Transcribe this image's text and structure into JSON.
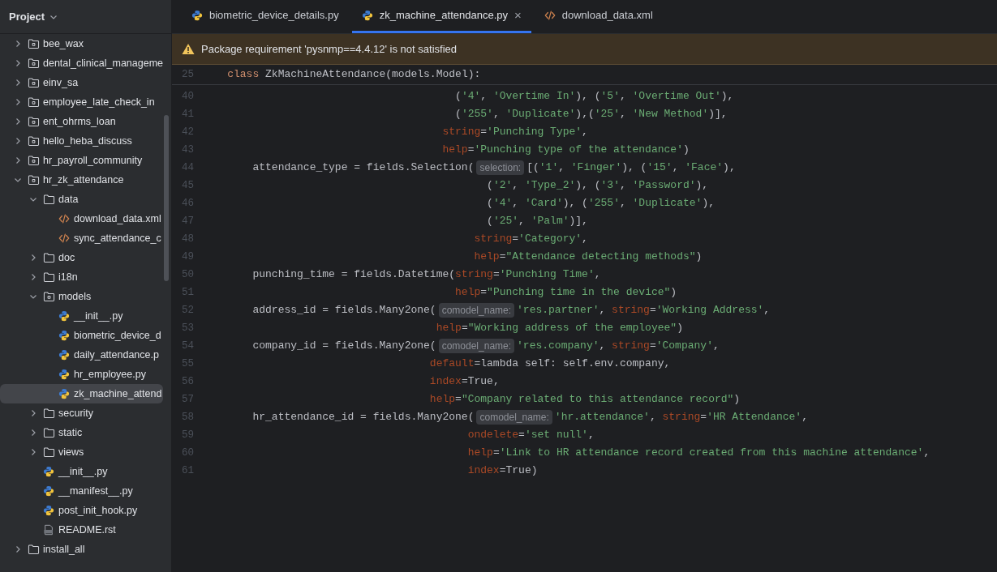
{
  "sidebar": {
    "title": "Project",
    "tree": [
      {
        "label": "bee_wax",
        "kind": "module",
        "expanded": false,
        "selected": false
      },
      {
        "label": "dental_clinical_manageme",
        "kind": "module",
        "expanded": false,
        "selected": false
      },
      {
        "label": "einv_sa",
        "kind": "module",
        "expanded": false,
        "selected": false
      },
      {
        "label": "employee_late_check_in",
        "kind": "module",
        "expanded": false,
        "selected": false
      },
      {
        "label": "ent_ohrms_loan",
        "kind": "module",
        "expanded": false,
        "selected": false
      },
      {
        "label": "hello_heba_discuss",
        "kind": "module",
        "expanded": false,
        "selected": false
      },
      {
        "label": "hr_payroll_community",
        "kind": "module",
        "expanded": false,
        "selected": false
      },
      {
        "label": "hr_zk_attendance",
        "kind": "module",
        "expanded": true,
        "selected": false,
        "children": [
          {
            "label": "data",
            "kind": "folder",
            "expanded": true,
            "selected": false,
            "children": [
              {
                "label": "download_data.xml",
                "kind": "xml",
                "selected": false
              },
              {
                "label": "sync_attendance_c",
                "kind": "xml",
                "selected": false
              }
            ]
          },
          {
            "label": "doc",
            "kind": "folder",
            "expanded": false,
            "selected": false
          },
          {
            "label": "i18n",
            "kind": "folder",
            "expanded": false,
            "selected": false
          },
          {
            "label": "models",
            "kind": "module",
            "expanded": true,
            "selected": false,
            "children": [
              {
                "label": "__init__.py",
                "kind": "python",
                "selected": false
              },
              {
                "label": "biometric_device_d",
                "kind": "python",
                "selected": false
              },
              {
                "label": "daily_attendance.p",
                "kind": "python",
                "selected": false
              },
              {
                "label": "hr_employee.py",
                "kind": "python",
                "selected": false
              },
              {
                "label": "zk_machine_attend",
                "kind": "python",
                "selected": true
              }
            ]
          },
          {
            "label": "security",
            "kind": "folder",
            "expanded": false,
            "selected": false
          },
          {
            "label": "static",
            "kind": "folder",
            "expanded": false,
            "selected": false
          },
          {
            "label": "views",
            "kind": "folder",
            "expanded": false,
            "selected": false
          },
          {
            "label": "__init__.py",
            "kind": "python",
            "selected": false
          },
          {
            "label": "__manifest__.py",
            "kind": "python",
            "selected": false
          },
          {
            "label": "post_init_hook.py",
            "kind": "python",
            "selected": false
          },
          {
            "label": "README.rst",
            "kind": "rst",
            "selected": false
          }
        ]
      },
      {
        "label": "install_all",
        "kind": "folder",
        "expanded": false,
        "selected": false
      }
    ]
  },
  "tabs": [
    {
      "label": "biometric_device_details.py",
      "kind": "python",
      "selected": false
    },
    {
      "label": "zk_machine_attendance.py",
      "kind": "python",
      "selected": true,
      "close": "×"
    },
    {
      "label": "download_data.xml",
      "kind": "xml",
      "selected": false
    }
  ],
  "banner": {
    "text": "Package requirement 'pysnmp==4.4.12' is not satisfied"
  },
  "editor": {
    "sticky_line": {
      "number": "25",
      "tokens": [
        {
          "kind": "keyword",
          "text": "    class"
        },
        {
          "kind": "plain",
          "text": " ZkMachineAttendance(models.Model):"
        }
      ]
    },
    "lines": [
      {
        "number": "40",
        "tokens": [
          {
            "kind": "plain",
            "text": "                                        ("
          },
          {
            "kind": "string",
            "text": "'4'"
          },
          {
            "kind": "plain",
            "text": ", "
          },
          {
            "kind": "string",
            "text": "'Overtime In'"
          },
          {
            "kind": "plain",
            "text": "), ("
          },
          {
            "kind": "string",
            "text": "'5'"
          },
          {
            "kind": "plain",
            "text": ", "
          },
          {
            "kind": "string",
            "text": "'Overtime Out'"
          },
          {
            "kind": "plain",
            "text": "),"
          }
        ]
      },
      {
        "number": "41",
        "tokens": [
          {
            "kind": "plain",
            "text": "                                        ("
          },
          {
            "kind": "string",
            "text": "'255'"
          },
          {
            "kind": "plain",
            "text": ", "
          },
          {
            "kind": "string",
            "text": "'Duplicate'"
          },
          {
            "kind": "plain",
            "text": "),("
          },
          {
            "kind": "string",
            "text": "'25'"
          },
          {
            "kind": "plain",
            "text": ", "
          },
          {
            "kind": "string",
            "text": "'New Method'"
          },
          {
            "kind": "plain",
            "text": ")],"
          }
        ]
      },
      {
        "number": "42",
        "tokens": [
          {
            "kind": "param",
            "text": "                                      string"
          },
          {
            "kind": "plain",
            "text": "="
          },
          {
            "kind": "string",
            "text": "'Punching Type'"
          },
          {
            "kind": "plain",
            "text": ","
          }
        ]
      },
      {
        "number": "43",
        "tokens": [
          {
            "kind": "param",
            "text": "                                      help"
          },
          {
            "kind": "plain",
            "text": "="
          },
          {
            "kind": "string",
            "text": "'Punching type of the attendance'"
          },
          {
            "kind": "plain",
            "text": ")"
          }
        ]
      },
      {
        "number": "44",
        "tokens": [
          {
            "kind": "plain",
            "text": "        attendance_type = fields.Selection("
          },
          {
            "kind": "hint",
            "text": "selection:"
          },
          {
            "kind": "plain",
            "text": "[("
          },
          {
            "kind": "string",
            "text": "'1'"
          },
          {
            "kind": "plain",
            "text": ", "
          },
          {
            "kind": "string",
            "text": "'Finger'"
          },
          {
            "kind": "plain",
            "text": "), ("
          },
          {
            "kind": "string",
            "text": "'15'"
          },
          {
            "kind": "plain",
            "text": ", "
          },
          {
            "kind": "string",
            "text": "'Face'"
          },
          {
            "kind": "plain",
            "text": "),"
          }
        ]
      },
      {
        "number": "45",
        "tokens": [
          {
            "kind": "plain",
            "text": "                                             ("
          },
          {
            "kind": "string",
            "text": "'2'"
          },
          {
            "kind": "plain",
            "text": ", "
          },
          {
            "kind": "string",
            "text": "'Type_2'"
          },
          {
            "kind": "plain",
            "text": "), ("
          },
          {
            "kind": "string",
            "text": "'3'"
          },
          {
            "kind": "plain",
            "text": ", "
          },
          {
            "kind": "string",
            "text": "'Password'"
          },
          {
            "kind": "plain",
            "text": "),"
          }
        ]
      },
      {
        "number": "46",
        "tokens": [
          {
            "kind": "plain",
            "text": "                                             ("
          },
          {
            "kind": "string",
            "text": "'4'"
          },
          {
            "kind": "plain",
            "text": ", "
          },
          {
            "kind": "string",
            "text": "'Card'"
          },
          {
            "kind": "plain",
            "text": "), ("
          },
          {
            "kind": "string",
            "text": "'255'"
          },
          {
            "kind": "plain",
            "text": ", "
          },
          {
            "kind": "string",
            "text": "'Duplicate'"
          },
          {
            "kind": "plain",
            "text": "),"
          }
        ]
      },
      {
        "number": "47",
        "tokens": [
          {
            "kind": "plain",
            "text": "                                             ("
          },
          {
            "kind": "string",
            "text": "'25'"
          },
          {
            "kind": "plain",
            "text": ", "
          },
          {
            "kind": "string",
            "text": "'Palm'"
          },
          {
            "kind": "plain",
            "text": ")],"
          }
        ]
      },
      {
        "number": "48",
        "tokens": [
          {
            "kind": "param",
            "text": "                                           string"
          },
          {
            "kind": "plain",
            "text": "="
          },
          {
            "kind": "string",
            "text": "'Category'"
          },
          {
            "kind": "plain",
            "text": ","
          }
        ]
      },
      {
        "number": "49",
        "tokens": [
          {
            "kind": "param",
            "text": "                                           help"
          },
          {
            "kind": "plain",
            "text": "="
          },
          {
            "kind": "string",
            "text": "\"Attendance detecting methods\""
          },
          {
            "kind": "plain",
            "text": ")"
          }
        ]
      },
      {
        "number": "50",
        "tokens": [
          {
            "kind": "plain",
            "text": "        punching_time = fields.Datetime("
          },
          {
            "kind": "param",
            "text": "string"
          },
          {
            "kind": "plain",
            "text": "="
          },
          {
            "kind": "string",
            "text": "'Punching Time'"
          },
          {
            "kind": "plain",
            "text": ","
          }
        ]
      },
      {
        "number": "51",
        "tokens": [
          {
            "kind": "param",
            "text": "                                        help"
          },
          {
            "kind": "plain",
            "text": "="
          },
          {
            "kind": "string",
            "text": "\"Punching time in the device\""
          },
          {
            "kind": "plain",
            "text": ")"
          }
        ]
      },
      {
        "number": "52",
        "tokens": [
          {
            "kind": "plain",
            "text": "        address_id = fields.Many2one("
          },
          {
            "kind": "hint",
            "text": "comodel_name:"
          },
          {
            "kind": "string",
            "text": "'res.partner'"
          },
          {
            "kind": "plain",
            "text": ", "
          },
          {
            "kind": "param",
            "text": "string"
          },
          {
            "kind": "plain",
            "text": "="
          },
          {
            "kind": "string",
            "text": "'Working Address'"
          },
          {
            "kind": "plain",
            "text": ","
          }
        ]
      },
      {
        "number": "53",
        "tokens": [
          {
            "kind": "param",
            "text": "                                     help"
          },
          {
            "kind": "plain",
            "text": "="
          },
          {
            "kind": "string",
            "text": "\"Working address of the employee\""
          },
          {
            "kind": "plain",
            "text": ")"
          }
        ]
      },
      {
        "number": "54",
        "tokens": [
          {
            "kind": "plain",
            "text": "        company_id = fields.Many2one("
          },
          {
            "kind": "hint",
            "text": "comodel_name:"
          },
          {
            "kind": "string",
            "text": "'res.company'"
          },
          {
            "kind": "plain",
            "text": ", "
          },
          {
            "kind": "param",
            "text": "string"
          },
          {
            "kind": "plain",
            "text": "="
          },
          {
            "kind": "string",
            "text": "'Company'"
          },
          {
            "kind": "plain",
            "text": ","
          }
        ]
      },
      {
        "number": "55",
        "tokens": [
          {
            "kind": "param",
            "text": "                                    default"
          },
          {
            "kind": "plain",
            "text": "=lambda self: self.env.company,"
          }
        ]
      },
      {
        "number": "56",
        "tokens": [
          {
            "kind": "param",
            "text": "                                    index"
          },
          {
            "kind": "plain",
            "text": "=True,"
          }
        ]
      },
      {
        "number": "57",
        "tokens": [
          {
            "kind": "param",
            "text": "                                    help"
          },
          {
            "kind": "plain",
            "text": "="
          },
          {
            "kind": "string",
            "text": "\"Company related to this attendance record\""
          },
          {
            "kind": "plain",
            "text": ")"
          }
        ]
      },
      {
        "number": "58",
        "tokens": [
          {
            "kind": "plain",
            "text": "        hr_attendance_id = fields.Many2one("
          },
          {
            "kind": "hint",
            "text": "comodel_name:"
          },
          {
            "kind": "string",
            "text": "'hr.attendance'"
          },
          {
            "kind": "plain",
            "text": ", "
          },
          {
            "kind": "param",
            "text": "string"
          },
          {
            "kind": "plain",
            "text": "="
          },
          {
            "kind": "string",
            "text": "'HR Attendance'"
          },
          {
            "kind": "plain",
            "text": ","
          }
        ]
      },
      {
        "number": "59",
        "tokens": [
          {
            "kind": "param",
            "text": "                                          ondelete"
          },
          {
            "kind": "plain",
            "text": "="
          },
          {
            "kind": "string",
            "text": "'set null'"
          },
          {
            "kind": "plain",
            "text": ","
          }
        ]
      },
      {
        "number": "60",
        "tokens": [
          {
            "kind": "param",
            "text": "                                          help"
          },
          {
            "kind": "plain",
            "text": "="
          },
          {
            "kind": "string",
            "text": "'Link to HR attendance record created from this machine attendance'"
          },
          {
            "kind": "plain",
            "text": ","
          }
        ]
      },
      {
        "number": "61",
        "tokens": [
          {
            "kind": "param",
            "text": "                                          index"
          },
          {
            "kind": "plain",
            "text": "=True)"
          }
        ]
      }
    ]
  }
}
